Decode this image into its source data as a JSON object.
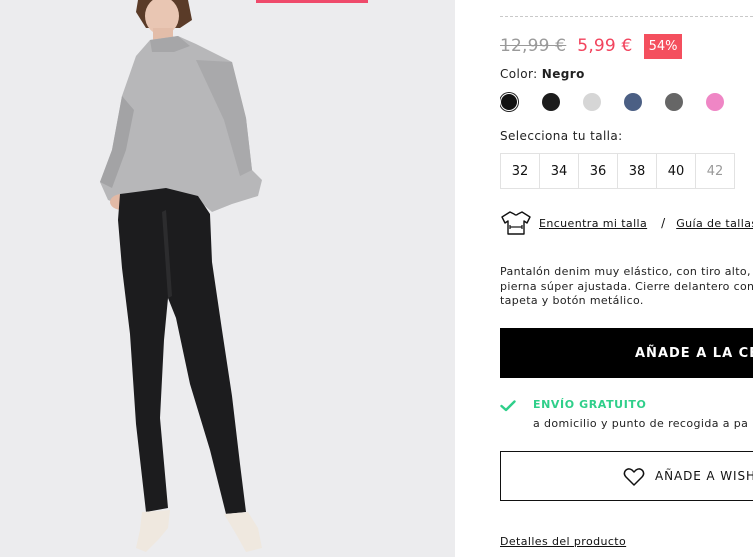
{
  "product": {
    "old_price": "12,99 €",
    "new_price": "5,99 €",
    "discount": "54%"
  },
  "color": {
    "label": "Color:",
    "selected_name": "Negro",
    "swatches": [
      {
        "name": "negro",
        "color": "#111111",
        "selected": true
      },
      {
        "name": "negro-2",
        "color": "#1c1c1c",
        "selected": false
      },
      {
        "name": "gris-claro",
        "color": "#d6d6d6",
        "selected": false
      },
      {
        "name": "azul-denim",
        "color": "#4b5f84",
        "selected": false
      },
      {
        "name": "gris-oscuro",
        "color": "#666666",
        "selected": false
      },
      {
        "name": "rosa",
        "color": "#ef86c5",
        "selected": false
      }
    ]
  },
  "sizes": {
    "label": "Selecciona tu talla:",
    "items": [
      {
        "label": "32",
        "available": true
      },
      {
        "label": "34",
        "available": true
      },
      {
        "label": "36",
        "available": true
      },
      {
        "label": "38",
        "available": true
      },
      {
        "label": "40",
        "available": true
      },
      {
        "label": "42",
        "available": false
      }
    ]
  },
  "fit": {
    "find_size": "Encuentra mi talla",
    "separator": "/",
    "size_guide": "Guía de tallas"
  },
  "description": [
    "Pantalón denim muy elástico, con tiro alto, s",
    "pierna súper ajustada. Cierre delantero con c",
    "tapeta y botón metálico."
  ],
  "actions": {
    "add_to_cart": "AÑADE A LA CESTA",
    "wishlist": "AÑADE A WISHLIST"
  },
  "shipping": {
    "title": "ENVÍO GRATUITO",
    "subtitle": "a domicilio y punto de recogida a pa"
  },
  "details_link": "Detalles del producto",
  "colors": {
    "accent_price": "#f2435d",
    "badge": "#f44f5e",
    "shipping_green": "#2fcf8a"
  }
}
